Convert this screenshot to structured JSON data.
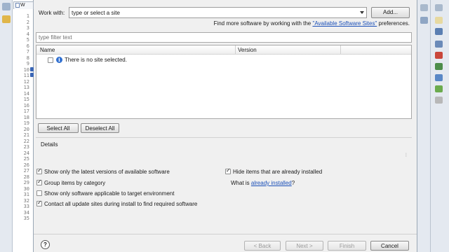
{
  "ide": {
    "editor_tab_label": "W",
    "line_numbers": [
      "1",
      "2",
      "3",
      "4",
      "5",
      "6",
      "7",
      "8",
      "9",
      "10",
      "11",
      "12",
      "13",
      "14",
      "15",
      "16",
      "17",
      "18",
      "19",
      "20",
      "21",
      "22",
      "23",
      "24",
      "25",
      "26",
      "27",
      "28",
      "29",
      "30",
      "31",
      "32",
      "33",
      "34",
      "35"
    ]
  },
  "dialog": {
    "work_with_label": "Work with:",
    "work_with_value": "type or select a site",
    "add_button": "Add...",
    "find_more_prefix": "Find more software by working with the ",
    "find_more_link": "\"Available Software Sites\"",
    "find_more_suffix": " preferences.",
    "filter_placeholder": "type filter text",
    "tree": {
      "columns": [
        "Name",
        "Version"
      ],
      "rows": [
        {
          "text": "There is no site selected.",
          "checked": false
        }
      ]
    },
    "select_all_button": "Select All",
    "deselect_all_button": "Deselect All",
    "details_label": "Details",
    "options": {
      "show_latest": {
        "label": "Show only the latest versions of available software",
        "checked": true
      },
      "group_by_category": {
        "label": "Group items by category",
        "checked": true
      },
      "applicable_only": {
        "label": "Show only software applicable to target environment",
        "checked": false
      },
      "contact_all_sites": {
        "label": "Contact all update sites during install to find required software",
        "checked": true
      },
      "hide_installed": {
        "label": "Hide items that are already installed",
        "checked": true
      },
      "what_is_prefix": "What is ",
      "already_installed_link": "already installed",
      "what_is_suffix": "?"
    },
    "footer": {
      "help": "?",
      "back": "< Back",
      "next": "Next >",
      "finish": "Finish",
      "cancel": "Cancel"
    }
  },
  "colors": {
    "link": "#1a4fb8",
    "dialog_bg": "#f0f0f0",
    "ide_frame": "#c9d3de"
  }
}
